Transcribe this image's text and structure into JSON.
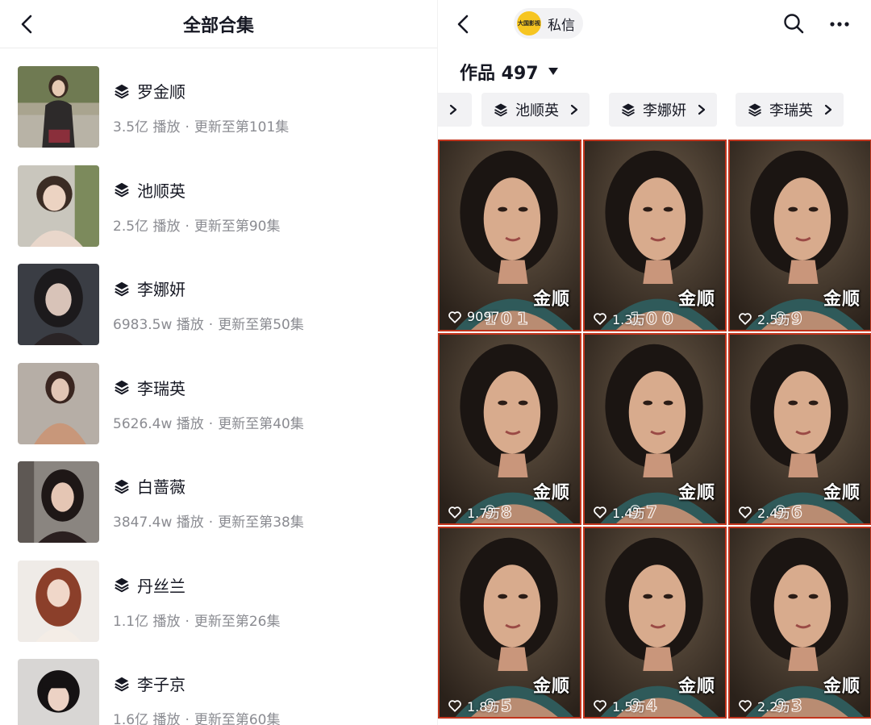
{
  "left": {
    "title": "全部合集",
    "collections": [
      {
        "name": "罗金顺",
        "plays": "3.5亿 播放",
        "update": "更新至第101集"
      },
      {
        "name": "池顺英",
        "plays": "2.5亿 播放",
        "update": "更新至第90集"
      },
      {
        "name": "李娜妍",
        "plays": "6983.5w 播放",
        "update": "更新至第50集"
      },
      {
        "name": "李瑞英",
        "plays": "5626.4w 播放",
        "update": "更新至第40集"
      },
      {
        "name": "白蔷薇",
        "plays": "3847.4w 播放",
        "update": "更新至第38集"
      },
      {
        "name": "丹丝兰",
        "plays": "1.1亿 播放",
        "update": "更新至第26集"
      },
      {
        "name": "李子京",
        "plays": "1.6亿 播放",
        "update": "更新至第60集"
      }
    ],
    "separator": "·"
  },
  "right": {
    "dm_label": "私信",
    "logo_text": "大国影视",
    "works_label": "作品 497",
    "chips": [
      "池顺英",
      "李娜妍",
      "李瑞英"
    ],
    "videos": [
      {
        "likes": "9097",
        "tag": "金顺",
        "ep": "101"
      },
      {
        "likes": "1.3万",
        "tag": "金顺",
        "ep": "100"
      },
      {
        "likes": "2.5万",
        "tag": "金顺",
        "ep": "99"
      },
      {
        "likes": "1.7万",
        "tag": "金顺",
        "ep": "98"
      },
      {
        "likes": "1.4万",
        "tag": "金顺",
        "ep": "97"
      },
      {
        "likes": "2.4万",
        "tag": "金顺",
        "ep": "96"
      },
      {
        "likes": "1.8万",
        "tag": "金顺",
        "ep": "95"
      },
      {
        "likes": "1.5万",
        "tag": "金顺",
        "ep": "94"
      },
      {
        "likes": "2.2万",
        "tag": "金顺",
        "ep": "93"
      }
    ]
  },
  "colors": {
    "text_primary": "#161823",
    "text_secondary": "#8a8b91",
    "chip_bg": "#f2f2f4",
    "thumb_border": "#c1341c",
    "logo_yellow": "#f6c521"
  },
  "icons": [
    "back-arrow-icon",
    "layers-icon",
    "search-icon",
    "more-icon",
    "chevron-right-icon",
    "caret-down-icon",
    "heart-icon"
  ]
}
